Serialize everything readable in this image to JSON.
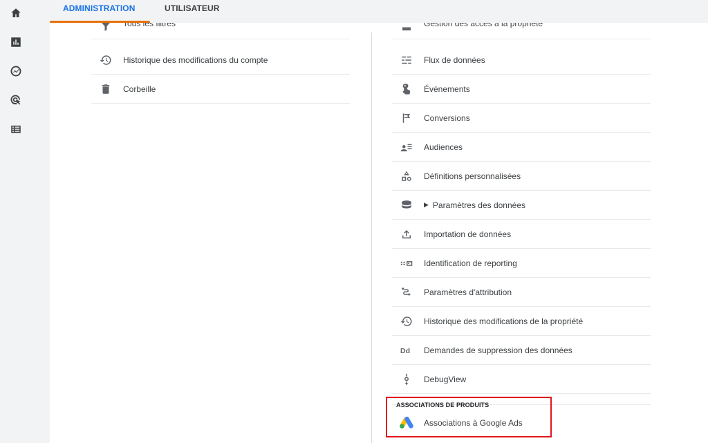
{
  "tabs": [
    {
      "label": "ADMINISTRATION",
      "active": true
    },
    {
      "label": "UTILISATEUR",
      "active": false
    }
  ],
  "rail": [
    {
      "icon": "home-icon"
    },
    {
      "icon": "reports-icon"
    },
    {
      "icon": "explore-icon"
    },
    {
      "icon": "advertising-icon"
    },
    {
      "icon": "configure-icon"
    }
  ],
  "account_column": {
    "items": [
      {
        "label": "Tous les filtres",
        "icon": "filter-icon"
      },
      {
        "label": "Historique des modifications du compte",
        "icon": "history-icon"
      },
      {
        "label": "Corbeille",
        "icon": "trash-icon"
      }
    ]
  },
  "property_column": {
    "items": [
      {
        "label": "Gestion des accès à la propriété",
        "icon": "access-icon"
      },
      {
        "label": "Flux de données",
        "icon": "data-streams-icon"
      },
      {
        "label": "Événements",
        "icon": "events-icon"
      },
      {
        "label": "Conversions",
        "icon": "flag-icon"
      },
      {
        "label": "Audiences",
        "icon": "audiences-icon"
      },
      {
        "label": "Définitions personnalisées",
        "icon": "custom-definitions-icon"
      },
      {
        "label": "Paramètres des données",
        "icon": "database-icon",
        "expandable": true
      },
      {
        "label": "Importation de données",
        "icon": "upload-icon"
      },
      {
        "label": "Identification de reporting",
        "icon": "reporting-identity-icon"
      },
      {
        "label": "Paramètres d'attribution",
        "icon": "attribution-icon"
      },
      {
        "label": "Historique des modifications de la propriété",
        "icon": "history-icon"
      },
      {
        "label": "Demandes de suppression des données",
        "icon": "data-deletion-icon"
      },
      {
        "label": "DebugView",
        "icon": "debug-icon"
      }
    ]
  },
  "product_links": {
    "heading": "ASSOCIATIONS DE PRODUITS",
    "item": {
      "label": "Associations à Google Ads",
      "icon": "google-ads-icon"
    }
  },
  "colors": {
    "accent": "#1a73e8",
    "tab_underline": "#e8710a",
    "highlight_border": "#e0161c"
  }
}
